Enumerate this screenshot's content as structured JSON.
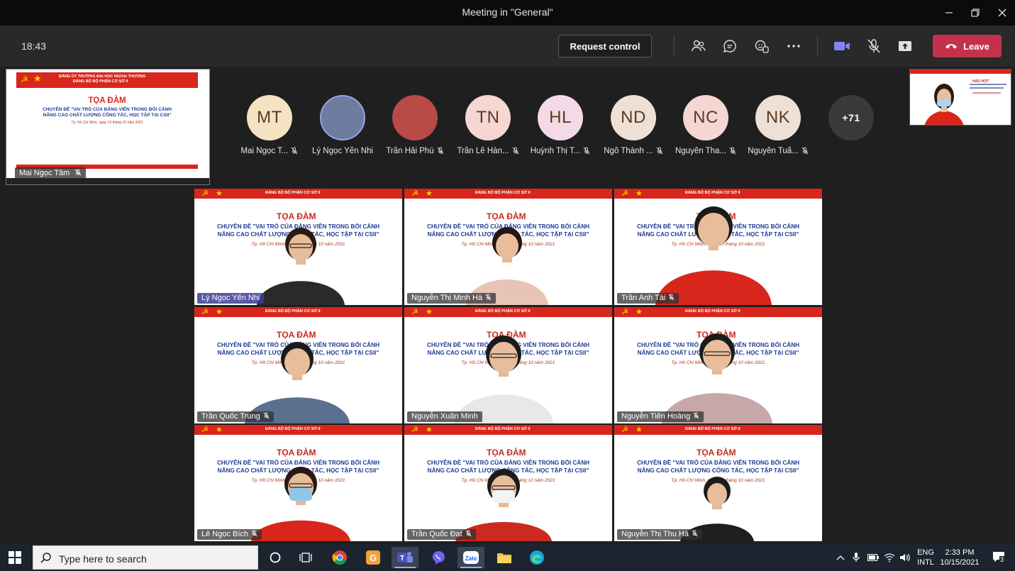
{
  "window": {
    "title": "Meeting in \"General\""
  },
  "toolbar": {
    "clock": "18:43",
    "request_control_label": "Request control",
    "leave_label": "Leave"
  },
  "shared_screen": {
    "header_line1": "ĐẢNG ỦY TRƯỜNG ĐẠI HỌC NGOẠI THƯƠNG",
    "header_line2": "ĐẢNG BỘ BỘ PHẬN CƠ SỞ II",
    "title": "TỌA ĐÀM",
    "line1": "CHUYÊN ĐỀ \"VAI TRÒ CỦA ĐẢNG VIÊN TRONG BỐI CẢNH",
    "line2": "NÂNG CAO CHẤT LƯỢNG CÔNG TÁC, HỌC TẬP TẠI CSII\"",
    "date": "Tp. Hồ Chí Minh, ngày 15 tháng 10 năm 2021",
    "presenter": "Mai Ngọc Tâm"
  },
  "self_view": {
    "header": "HẢO HỢT"
  },
  "strip": [
    {
      "initials": "MT",
      "name": "Mai Ngọc T...",
      "bg": "#f4e3c2",
      "muted": true
    },
    {
      "initials": "",
      "name": "Lý Ngọc Yến Nhi",
      "bg": "#6c7da0",
      "muted": false,
      "photo": true
    },
    {
      "initials": "",
      "name": "Trần Hải Phú",
      "bg": "#b84a48",
      "muted": true,
      "photo": true
    },
    {
      "initials": "TN",
      "name": "Trần Lê Hàn...",
      "bg": "#f6d6d3",
      "muted": true
    },
    {
      "initials": "HL",
      "name": "Huỳnh Thị T...",
      "bg": "#f4d9e6",
      "muted": true
    },
    {
      "initials": "ND",
      "name": "Ngô Thành ...",
      "bg": "#efe0d6",
      "muted": true
    },
    {
      "initials": "NC",
      "name": "Nguyễn Tha...",
      "bg": "#f6d6d3",
      "muted": true
    },
    {
      "initials": "NK",
      "name": "Nguyễn Tuấ...",
      "bg": "#efe0d6",
      "muted": true
    },
    {
      "initials": "+71",
      "name": "",
      "bg": "#3a3a3a",
      "muted": false
    }
  ],
  "slide": {
    "header": "ĐẢNG BỘ BỘ PHẬN CƠ SỞ II",
    "title": "TỌA ĐÀM",
    "line1": "CHUYÊN ĐỀ \"VAI TRÒ CỦA ĐẢNG VIÊN TRONG BỐI CẢNH",
    "line2": "NÂNG CAO CHẤT LƯỢNG CÔNG TÁC, HỌC TẬP TẠI CSII\"",
    "date": "Tp. Hồ Chí Minh, ngày 15 tháng 10 năm 2021"
  },
  "tiles": [
    {
      "name": "Lý Ngọc Yến Nhi",
      "muted": false,
      "active": true,
      "shirt": "#2a2a2a",
      "hair": "#2b1a12",
      "mask": false
    },
    {
      "name": "Nguyễn Thị Minh Hà",
      "muted": true,
      "active": false,
      "shirt": "#e8c4b6",
      "hair": "#241612",
      "mask": false
    },
    {
      "name": "Trần Anh Tài",
      "muted": true,
      "active": false,
      "shirt": "#d8261c",
      "hair": "#1b1b1b",
      "mask": false
    },
    {
      "name": "Trần Quốc Trung",
      "muted": true,
      "active": false,
      "shirt": "#5b6f8e",
      "hair": "#1b1b1b",
      "mask": false
    },
    {
      "name": "Nguyễn Xuân Minh",
      "muted": false,
      "active": false,
      "shirt": "#e8e8e8",
      "hair": "#1b1b1b",
      "mask": false
    },
    {
      "name": "Nguyễn Tiến Hoàng",
      "muted": true,
      "active": false,
      "shirt": "#c7a8a8",
      "hair": "#1b1b1b",
      "mask": false
    },
    {
      "name": "Lê Ngọc Bích",
      "muted": true,
      "active": false,
      "shirt": "#d8261c",
      "hair": "#2b1a12",
      "mask": true
    },
    {
      "name": "Trần Quốc Đạt",
      "muted": true,
      "active": false,
      "shirt": "#cc2a20",
      "hair": "#1b1b1b",
      "mask": true
    },
    {
      "name": "Nguyễn Thị Thu Hà",
      "muted": true,
      "active": false,
      "shirt": "#1e1e1e",
      "hair": "#1b1b1b",
      "mask": false
    }
  ],
  "taskbar": {
    "search_placeholder": "Type here to search",
    "lang_top": "ENG",
    "lang_bottom": "INTL",
    "time": "2:33 PM",
    "date": "10/15/2021",
    "notifications": "3"
  }
}
